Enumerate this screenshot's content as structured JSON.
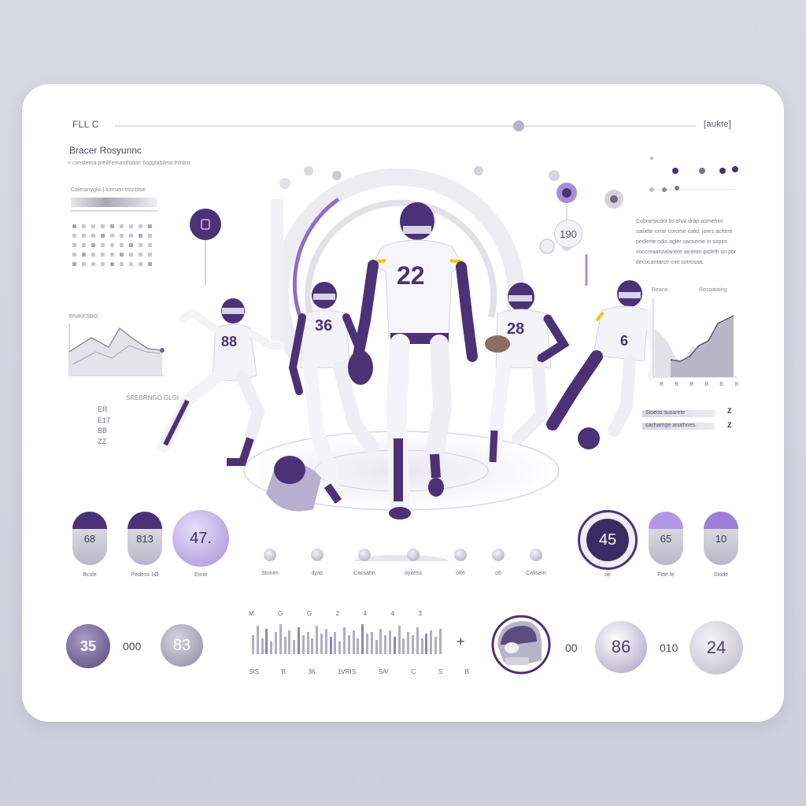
{
  "header": {
    "left_label": "FLL C",
    "right_label": "[aukte]"
  },
  "left_panel": {
    "title": "Bracer Rosyunnc",
    "subtitle": "+ constema preilFemanthaton Sopplabileat thinbsr",
    "bar_label": "Caleranyglis | lumsen trezzitse",
    "chart_label": "RNIKESBO",
    "stats_label": "SREBRNGO GLGI",
    "stats_values": [
      "ER",
      "E17",
      "BB",
      "ZZ"
    ]
  },
  "right_panel": {
    "paragraph": "Cobrarsicdot lis ahar drap aomehim saiiiete orrar corome calid. jores achent pedlerte odic agler sacneme in sopim voccreaatstalanete aiceran prdeth on pbr decucantarce ove sotrosaa.",
    "chart_left_label": "Reane.",
    "chart_right_label": "Rosoataing",
    "chart_ticks": [
      "B",
      "B",
      "B",
      "B",
      "B",
      "B"
    ],
    "legend_rows": [
      "Sioeos susarete",
      "sachamge anathnes."
    ],
    "legend_marks": [
      "Z",
      "Z"
    ]
  },
  "players": [
    {
      "number": "88"
    },
    {
      "number": "36"
    },
    {
      "number": "22"
    },
    {
      "number": "28"
    },
    {
      "number": "6"
    }
  ],
  "badge_value": "190",
  "stats_row": {
    "left_pills": [
      {
        "value": "68",
        "label": "Bcole"
      },
      {
        "value": "813",
        "label": "Pedess 1Ø"
      }
    ],
    "left_circle": {
      "value": "47.",
      "label": "Eone"
    },
    "knob_labels": [
      "Stonim",
      "dyas",
      "Cassahn",
      "oyitess",
      "ofte",
      "o5",
      "Calisern"
    ],
    "right_circle": {
      "value": "45",
      "label": "oe"
    },
    "right_pills": [
      {
        "value": "65",
        "label": "Fitte fe"
      },
      {
        "value": "10",
        "label": "Stode"
      }
    ]
  },
  "bottom_row": {
    "left_circle_value": "35",
    "left_text": "000",
    "mid_circle_value": "83",
    "wave_top_labels": [
      "M",
      "G",
      "G",
      "2",
      "4",
      "4",
      "3"
    ],
    "wave_bottom_labels": [
      "SIS",
      "B",
      "36",
      "1VRIS",
      "SA/",
      "C",
      "S",
      "B"
    ],
    "cross_symbol": "+",
    "right_text_a": "00",
    "circle_86": "86",
    "right_text_b": "010",
    "circle_24": "24"
  },
  "colors": {
    "accent": "#4b3277",
    "accent_light": "#a68fd6",
    "gold": "#f2c300"
  }
}
